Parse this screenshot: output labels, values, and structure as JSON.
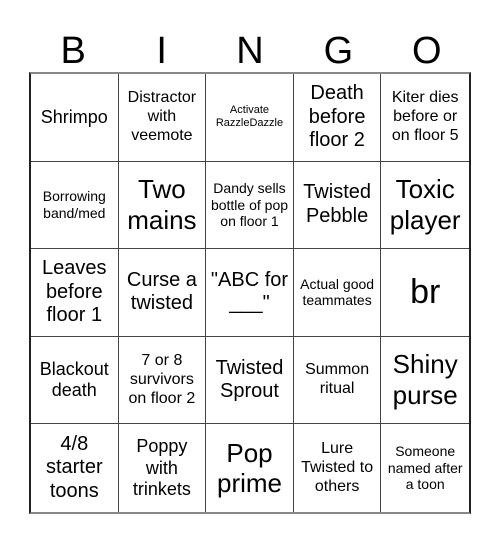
{
  "header": [
    "B",
    "I",
    "N",
    "G",
    "O"
  ],
  "cells": [
    "Shrimpo",
    "Distractor with veemote",
    "Activate RazzleDazzle",
    "Death before floor 2",
    "Kiter dies before or on floor 5",
    "Borrowing band/med",
    "Two mains",
    "Dandy sells bottle of pop on floor 1",
    "Twisted Pebble",
    "Toxic player",
    "Leaves before floor 1",
    "Curse a twisted",
    "\"ABC for ___\"",
    "Actual good teammates",
    "br",
    "Blackout death",
    "7 or 8 survivors on floor 2",
    "Twisted Sprout",
    "Summon ritual",
    "Shiny purse",
    "4/8 starter toons",
    "Poppy with trinkets",
    "Pop prime",
    "Lure Twisted to others",
    "Someone named after a toon"
  ]
}
